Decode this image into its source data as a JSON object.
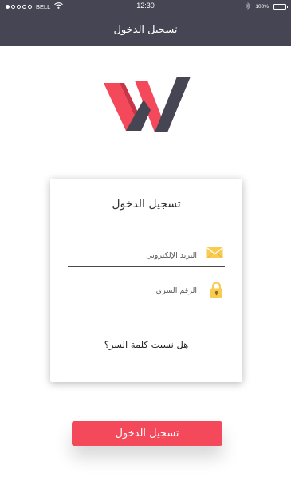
{
  "status_bar": {
    "carrier": "BELL",
    "time": "12:30",
    "battery_label": "100%",
    "signal_bars_filled": 1,
    "signal_bars_total": 5,
    "icons": [
      "wifi-icon",
      "bluetooth-icon",
      "battery-icon"
    ]
  },
  "nav": {
    "title": "تسجيل الدخول"
  },
  "logo": {
    "colors": {
      "red": "#f4485b",
      "dark": "#454553"
    }
  },
  "card": {
    "title": "تسجيل الدخول",
    "email": {
      "placeholder": "البريد الإلكتروني",
      "value": "",
      "icon": "envelope-icon",
      "icon_color": "#f9cb51"
    },
    "password": {
      "placeholder": "الرقم السري",
      "value": "",
      "icon": "lock-icon",
      "icon_color": "#f9cb51"
    },
    "forgot_link": "هل نسيت كلمة السر؟"
  },
  "login_button": {
    "label": "تسجيل الدخول",
    "color": "#f4485b"
  }
}
